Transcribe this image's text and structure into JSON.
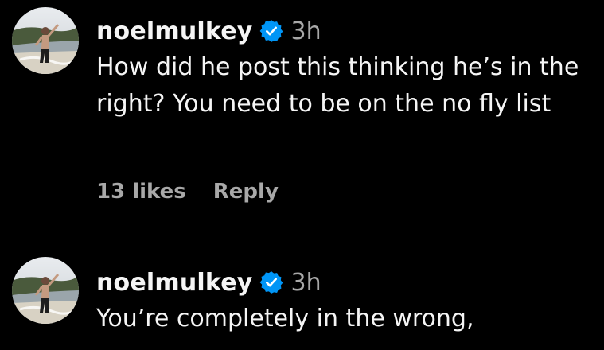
{
  "comments": [
    {
      "username": "noelmulkey",
      "verified_icon": "verified-badge-icon",
      "time": "3h",
      "text": "How did he post this thinking he’s in the right? You need to be on the no fly list",
      "likes": "13 likes",
      "reply_label": "Reply"
    },
    {
      "username": "noelmulkey",
      "verified_icon": "verified-badge-icon",
      "time": "3h",
      "text": "You’re completely in the wrong,"
    }
  ],
  "colors": {
    "background": "#000000",
    "primary_text": "#f5f5f5",
    "secondary_text": "#a8a8a8",
    "verified_badge": "#0095f6"
  }
}
